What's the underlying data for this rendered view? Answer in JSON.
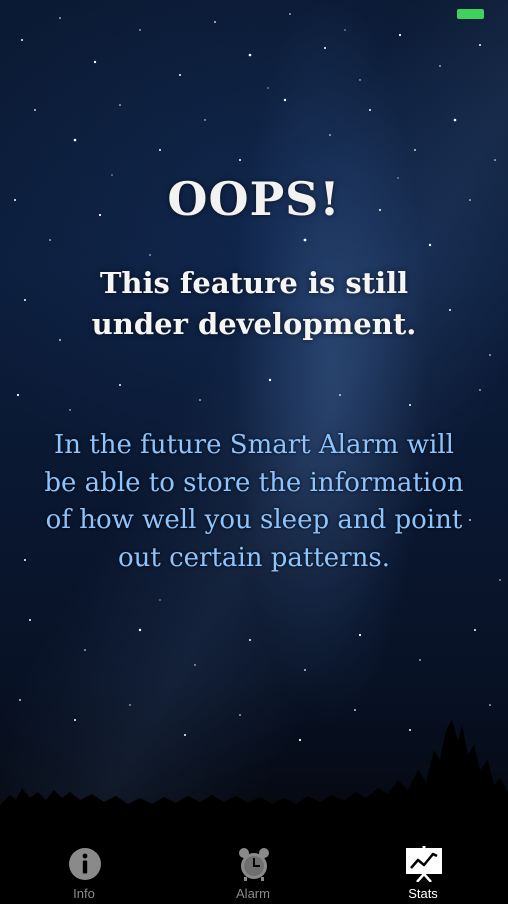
{
  "status_bar": {
    "battery_color": "#3fd15c"
  },
  "content": {
    "title": "OOPS!",
    "subtitle": "This feature is still under development.",
    "description": "In the future Smart Alarm will be able to store the information of how well you sleep and point out certain patterns."
  },
  "tab_bar": {
    "active_tab": "Stats",
    "tabs": [
      {
        "label": "Info",
        "icon": "info-icon"
      },
      {
        "label": "Alarm",
        "icon": "alarm-clock-icon"
      },
      {
        "label": "Stats",
        "icon": "stats-chart-icon"
      }
    ]
  },
  "colors": {
    "title": "#f2f2f2",
    "description": "#8cc4ff",
    "tab_inactive": "#8a8a8a",
    "tab_active": "#ffffff"
  }
}
